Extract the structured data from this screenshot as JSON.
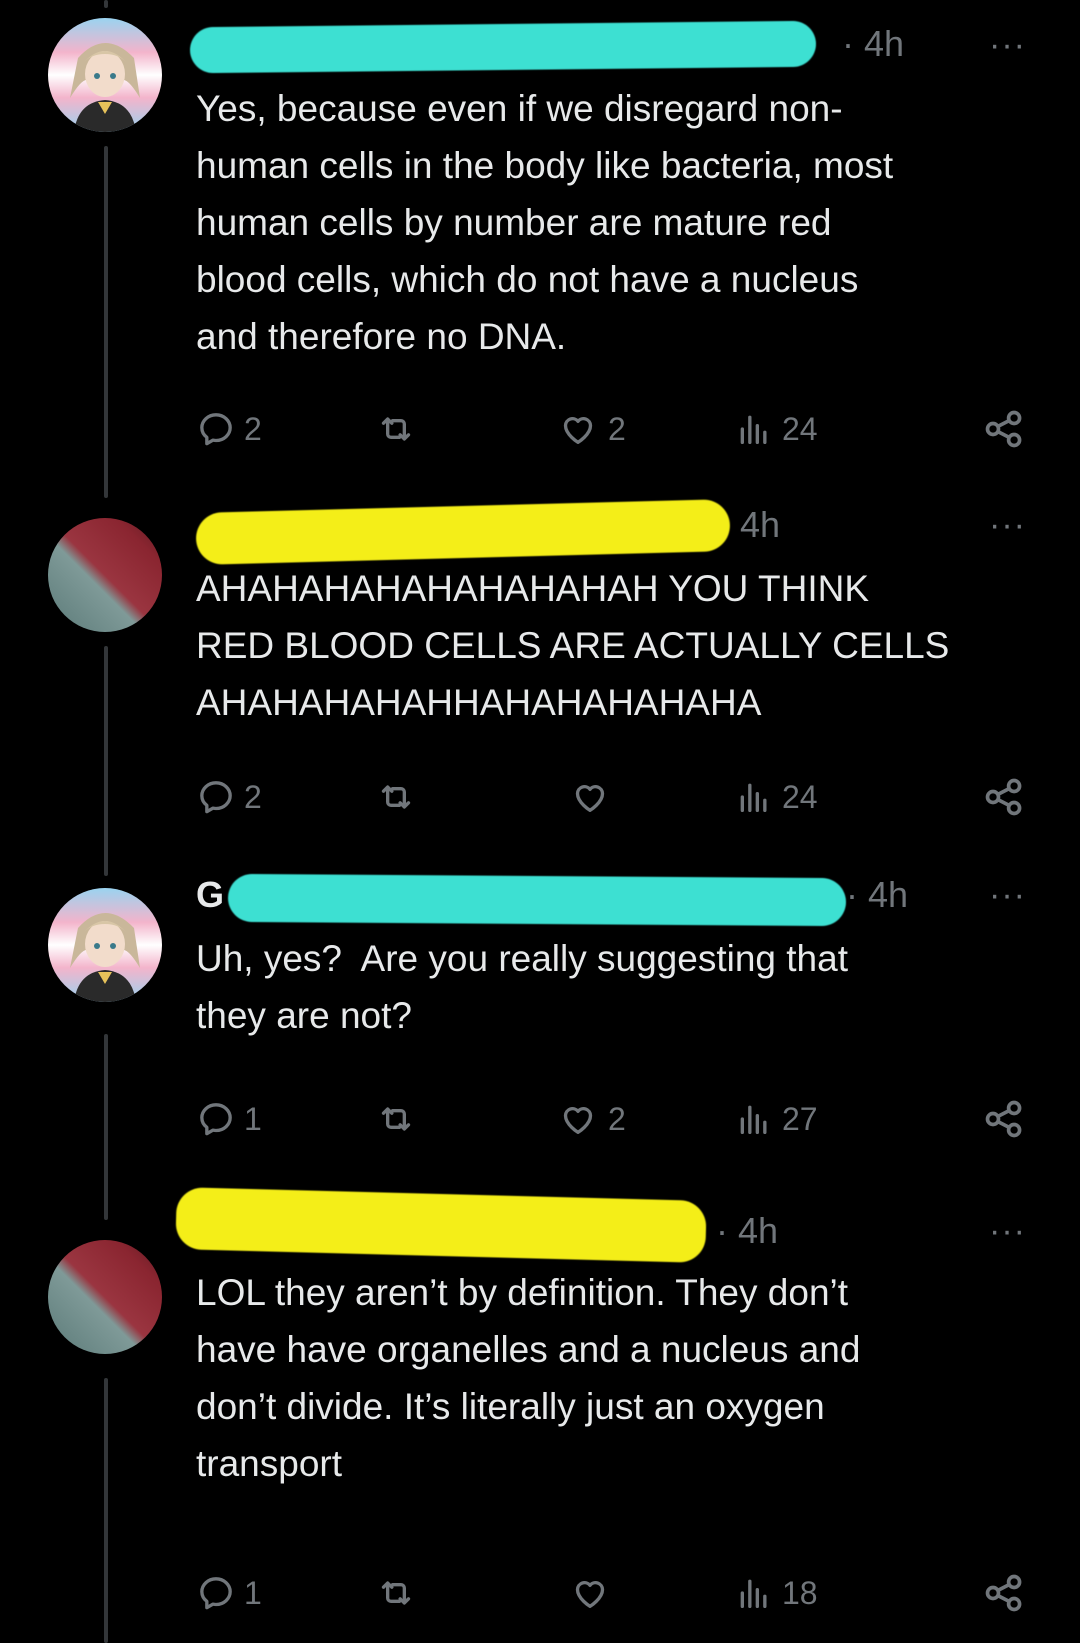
{
  "colors": {
    "background": "#000000",
    "text": "#e7e9ea",
    "muted": "#71767b",
    "redact_cyan": "#3de0d2",
    "redact_yellow": "#f4ee18",
    "thread_line": "#333639"
  },
  "tweets": [
    {
      "avatar": "anime-character-avatar",
      "name_redaction": "cyan",
      "name_initial": "",
      "time": "· 4h",
      "more": "···",
      "text": "Yes, because even if we disregard non-human cells in the body like bacteria, most human cells by number are mature red blood cells, which do not have a nucleus and therefore no DNA.",
      "lines": [
        "Yes, because even if we disregard non-",
        "human cells in the body like bacteria, most",
        "human cells by number are mature red",
        "blood cells, which do not have a nucleus",
        "and therefore no DNA."
      ],
      "replies": "2",
      "retweets": "",
      "likes": "2",
      "views": "24",
      "share_icon": "share-icon"
    },
    {
      "avatar": "blurred-red-avatar",
      "name_redaction": "yellow",
      "name_initial": "",
      "time": "4h",
      "more": "···",
      "lines": [
        "AHAHAHAHAHAHAHAHAH YOU THINK",
        "RED BLOOD CELLS ARE ACTUALLY CELLS",
        "AHAHAHAHAHHAHAHAHAHAHA"
      ],
      "replies": "2",
      "retweets": "",
      "likes": "",
      "views": "24",
      "share_icon": "share-icon"
    },
    {
      "avatar": "anime-character-avatar",
      "name_redaction": "cyan",
      "name_initial": "G",
      "time": "· 4h",
      "more": "···",
      "lines": [
        "Uh, yes?  Are you really suggesting that",
        "they are not?"
      ],
      "replies": "1",
      "retweets": "",
      "likes": "2",
      "views": "27",
      "share_icon": "share-icon"
    },
    {
      "avatar": "blurred-red-avatar",
      "name_redaction": "yellow",
      "name_initial": "",
      "time": "· 4h",
      "more": "···",
      "lines": [
        "LOL they aren’t by definition. They don’t",
        "have have organelles and a nucleus and",
        "don’t divide. It’s literally just an oxygen",
        "transport"
      ],
      "replies": "1",
      "retweets": "",
      "likes": "",
      "views": "18",
      "share_icon": "share-icon"
    }
  ]
}
